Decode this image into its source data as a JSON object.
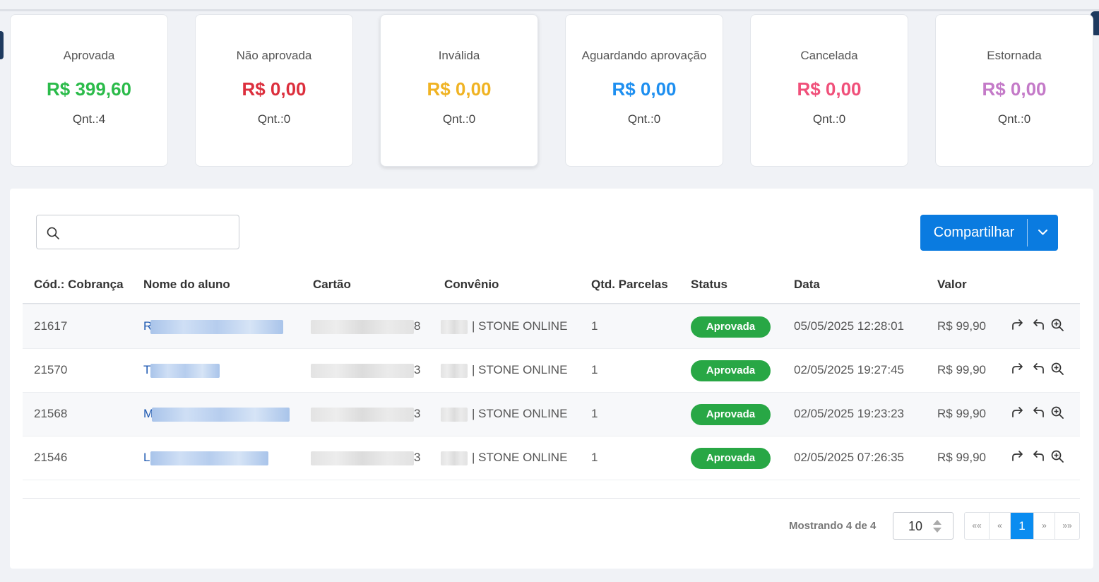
{
  "summary_cards": [
    {
      "label": "Aprovada",
      "amount": "R$ 399,60",
      "count": "Qnt.:4",
      "color": "#2bbb4a"
    },
    {
      "label": "Não aprovada",
      "amount": "R$ 0,00",
      "count": "Qnt.:0",
      "color": "#dc2f3d"
    },
    {
      "label": "Inválida",
      "amount": "R$ 0,00",
      "count": "Qnt.:0",
      "color": "#f0b323"
    },
    {
      "label": "Aguardando aprovação",
      "amount": "R$ 0,00",
      "count": "Qnt.:0",
      "color": "#1e8ff0"
    },
    {
      "label": "Cancelada",
      "amount": "R$ 0,00",
      "count": "Qnt.:0",
      "color": "#f0507a"
    },
    {
      "label": "Estornada",
      "amount": "R$ 0,00",
      "count": "Qnt.:0",
      "color": "#c47ac8"
    }
  ],
  "search": {
    "placeholder": "",
    "icon": "search-icon"
  },
  "share_button": {
    "label": "Compartilhar",
    "color": "#0a7be0"
  },
  "table": {
    "columns": [
      "Cód.: Cobrança",
      "Nome do aluno",
      "Cartão",
      "Convênio",
      "Qtd. Parcelas",
      "Status",
      "Data",
      "Valor"
    ],
    "rows": [
      {
        "code": "21617",
        "name_initial": "R",
        "card_last": "8",
        "agreement": "| STONE ONLINE",
        "installments": "1",
        "status": "Aprovada",
        "date": "05/05/2025 12:28:01",
        "value": "R$ 99,90"
      },
      {
        "code": "21570",
        "name_initial": "T",
        "card_last": "3",
        "agreement": "| STONE ONLINE",
        "installments": "1",
        "status": "Aprovada",
        "date": "02/05/2025 19:27:45",
        "value": "R$ 99,90"
      },
      {
        "code": "21568",
        "name_initial": "M",
        "card_last": "3",
        "agreement": "| STONE ONLINE",
        "installments": "1",
        "status": "Aprovada",
        "date": "02/05/2025 19:23:23",
        "value": "R$ 99,90"
      },
      {
        "code": "21546",
        "name_initial": "L",
        "card_last": "3",
        "agreement": "| STONE ONLINE",
        "installments": "1",
        "status": "Aprovada",
        "date": "02/05/2025 07:26:35",
        "value": "R$ 99,90"
      }
    ],
    "status_color": "#28a745",
    "row_actions": [
      "share-forward-icon",
      "undo-icon",
      "zoom-in-icon"
    ]
  },
  "pagination": {
    "showing": "Mostrando 4 de 4",
    "page_size": "10",
    "first": "««",
    "prev": "«",
    "current": "1",
    "next": "»",
    "last": "»»"
  }
}
